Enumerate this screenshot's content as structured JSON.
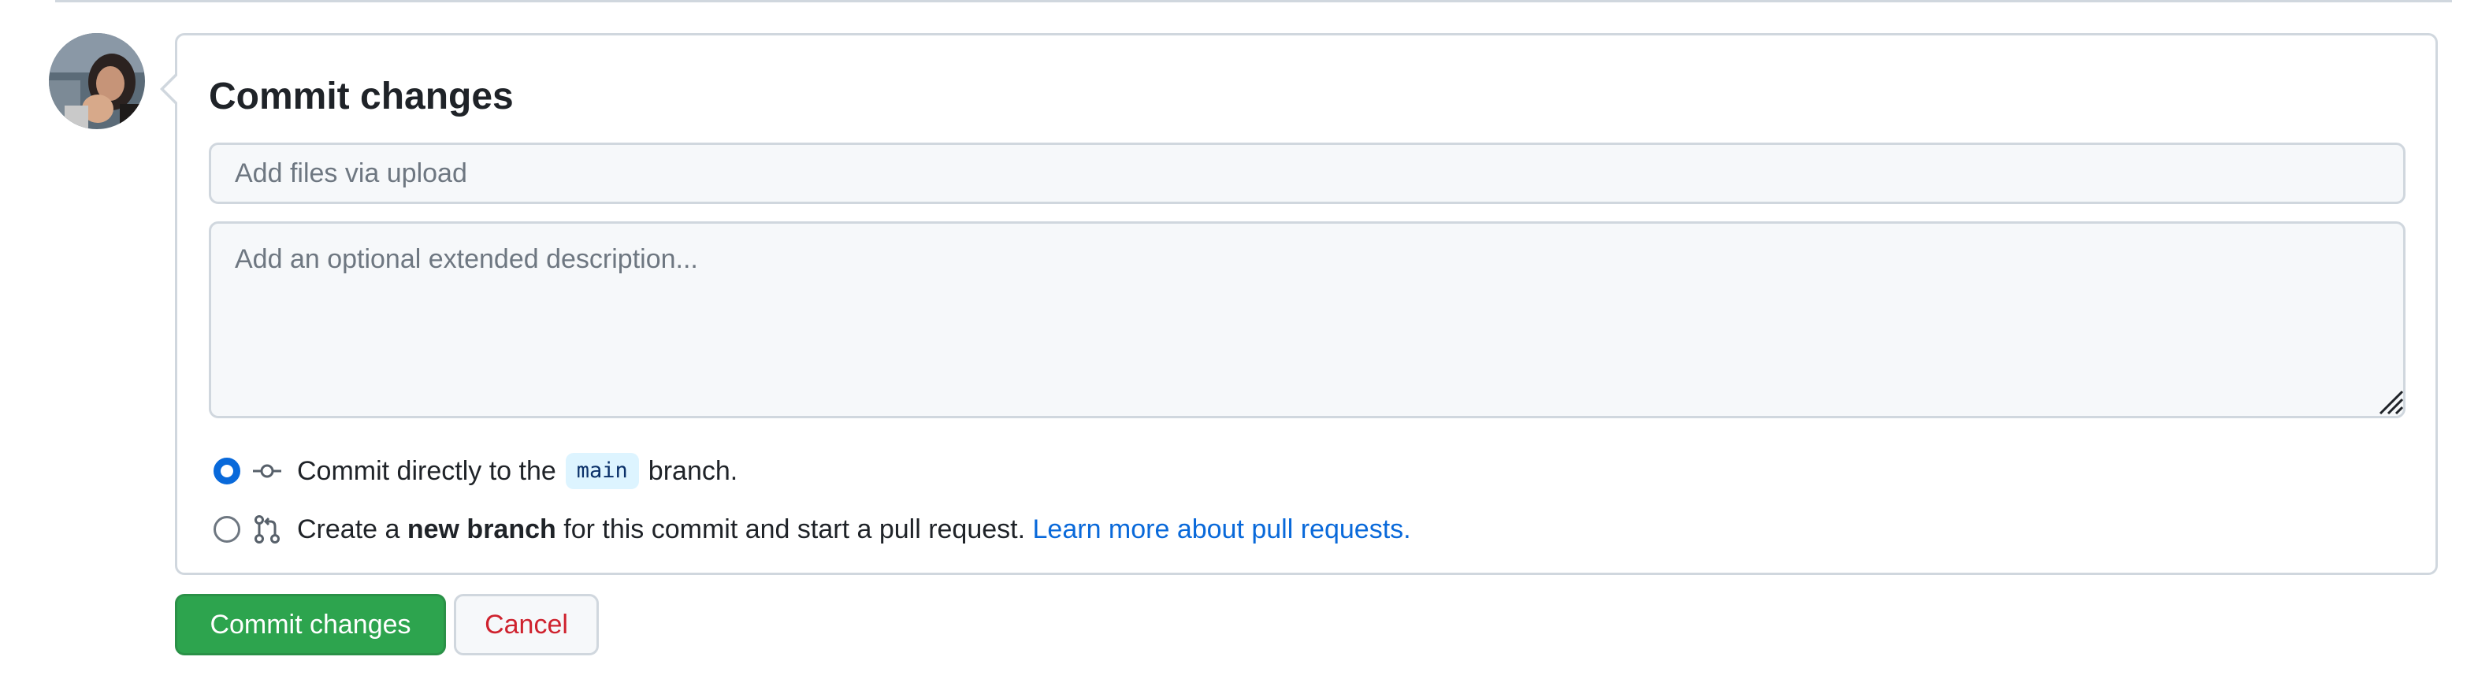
{
  "form": {
    "heading": "Commit changes",
    "summary_placeholder": "Add files via upload",
    "summary_value": "",
    "description_placeholder": "Add an optional extended description...",
    "description_value": ""
  },
  "options": {
    "direct": {
      "selected": true,
      "icon": "git-commit-icon",
      "text_before": "Commit directly to the",
      "branch": "main",
      "text_after": "branch."
    },
    "new_branch": {
      "selected": false,
      "icon": "git-pull-request-icon",
      "text_before": "Create a",
      "emphasis": "new branch",
      "text_after": "for this commit and start a pull request.",
      "link": "Learn more about pull requests."
    }
  },
  "buttons": {
    "commit": "Commit changes",
    "cancel": "Cancel"
  },
  "colors": {
    "primary_button": "#2da44e",
    "link": "#0969da",
    "cancel_text": "#cf222e",
    "branch_tag_bg": "#ddf4ff"
  }
}
